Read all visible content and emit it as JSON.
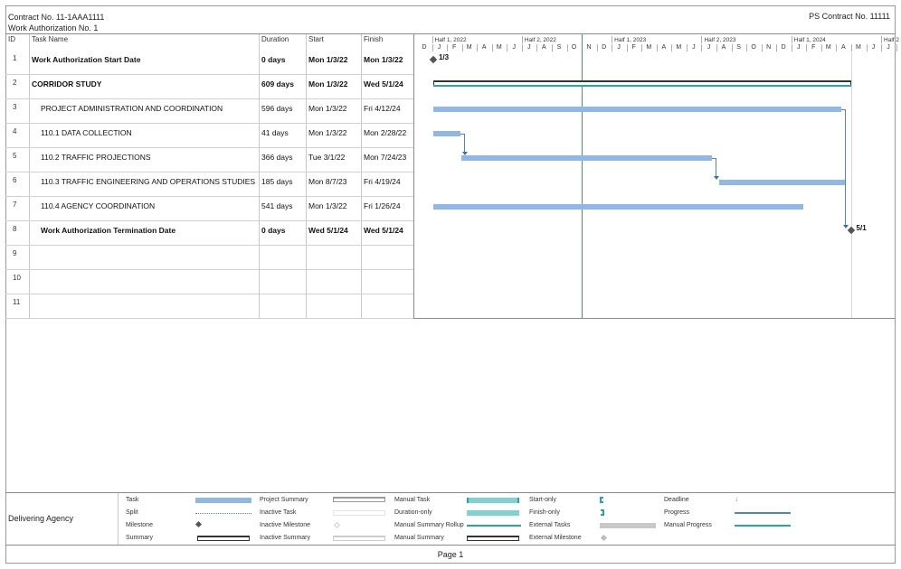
{
  "header": {
    "contract": "Contract No. 11-1AAA1111",
    "work_authorization": "Work Authorization No. 1",
    "ps_contract": "PS Contract No. 11111"
  },
  "columns": {
    "id": "ID",
    "task_name": "Task Name",
    "duration": "Duration",
    "start": "Start",
    "finish": "Finish"
  },
  "timescale": {
    "halves": [
      "Half 1, 2022",
      "Half 2, 2022",
      "Half 1, 2023",
      "Half 2, 2023",
      "Half 1, 2024",
      "Half 2"
    ],
    "months": [
      "D",
      "J",
      "F",
      "M",
      "A",
      "M",
      "J",
      "J",
      "A",
      "S",
      "O",
      "N",
      "D",
      "J",
      "F",
      "M",
      "A",
      "M",
      "J",
      "J",
      "A",
      "S",
      "O",
      "N",
      "D",
      "J",
      "F",
      "M",
      "A",
      "M",
      "J",
      "J"
    ]
  },
  "tasks": [
    {
      "id": "1",
      "name": "Work Authorization Start Date",
      "duration": "0 days",
      "start": "Mon 1/3/22",
      "finish": "Mon 1/3/22",
      "bold": true,
      "type": "milestone",
      "label": "1/3"
    },
    {
      "id": "2",
      "name": "CORRIDOR STUDY",
      "duration": "609 days",
      "start": "Mon 1/3/22",
      "finish": "Wed 5/1/24",
      "bold": true,
      "type": "summary"
    },
    {
      "id": "3",
      "name": "PROJECT ADMINISTRATION AND COORDINATION",
      "duration": "596 days",
      "start": "Mon 1/3/22",
      "finish": "Fri 4/12/24",
      "bold": false,
      "type": "task"
    },
    {
      "id": "4",
      "name": "110.1 DATA COLLECTION",
      "duration": "41 days",
      "start": "Mon 1/3/22",
      "finish": "Mon 2/28/22",
      "bold": false,
      "type": "task"
    },
    {
      "id": "5",
      "name": "110.2 TRAFFIC PROJECTIONS",
      "duration": "366 days",
      "start": "Tue 3/1/22",
      "finish": "Mon 7/24/23",
      "bold": false,
      "type": "task"
    },
    {
      "id": "6",
      "name": "110.3 TRAFFIC ENGINEERING AND OPERATIONS STUDIES",
      "duration": "185 days",
      "start": "Mon 8/7/23",
      "finish": "Fri 4/19/24",
      "bold": false,
      "type": "task"
    },
    {
      "id": "7",
      "name": "110.4 AGENCY COORDINATION",
      "duration": "541 days",
      "start": "Mon 1/3/22",
      "finish": "Fri 1/26/24",
      "bold": false,
      "type": "task"
    },
    {
      "id": "8",
      "name": "Work Authorization Termination Date",
      "duration": "0 days",
      "start": "Wed 5/1/24",
      "finish": "Wed 5/1/24",
      "bold": true,
      "type": "milestone",
      "label": "5/1"
    },
    {
      "id": "9",
      "name": "",
      "duration": "",
      "start": "",
      "finish": ""
    },
    {
      "id": "10",
      "name": "",
      "duration": "",
      "start": "",
      "finish": ""
    },
    {
      "id": "11",
      "name": "",
      "duration": "",
      "start": "",
      "finish": ""
    }
  ],
  "legend": {
    "agency": "Delivering Agency",
    "col1": [
      "Task",
      "Split",
      "Milestone",
      "Summary"
    ],
    "col2": [
      "Project Summary",
      "Inactive Task",
      "Inactive Milestone",
      "Inactive Summary"
    ],
    "col3": [
      "Manual Task",
      "Duration-only",
      "Manual Summary Rollup",
      "Manual Summary"
    ],
    "col4": [
      "Start-only",
      "Finish-only",
      "External Tasks",
      "External Milestone"
    ],
    "col5": [
      "Deadline",
      "Progress",
      "Manual Progress"
    ]
  },
  "footer": {
    "page": "Page 1"
  },
  "colors": {
    "task_bar": "#8fb8e6",
    "progress": "#2aa3b0",
    "today": "#3daa4a",
    "summary": "#333333"
  }
}
